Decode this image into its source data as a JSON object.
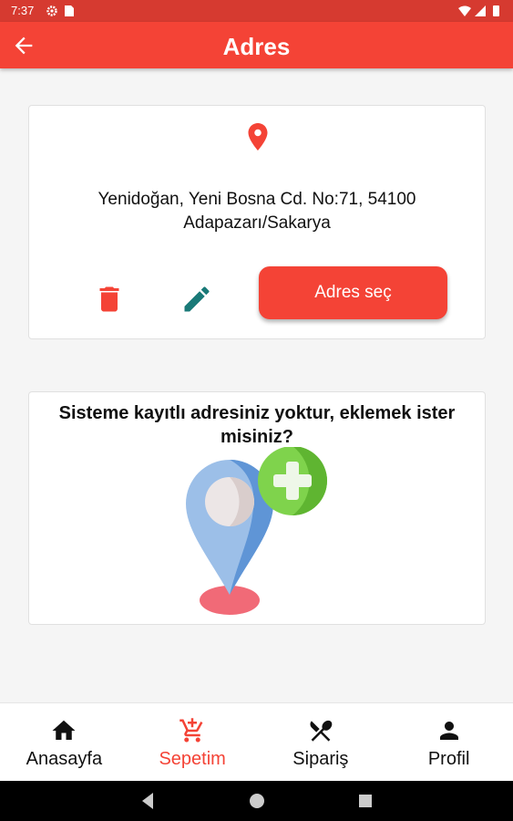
{
  "status_bar": {
    "time": "7:37",
    "left_icons": [
      "gear-icon",
      "sd-card-icon"
    ],
    "right_icons": [
      "wifi-icon",
      "signal-icon",
      "battery-icon"
    ]
  },
  "app_bar": {
    "title": "Adres",
    "back_icon": "arrow-back-icon"
  },
  "address_card": {
    "icon": "location-pin-icon",
    "address_line1": "Yenidoğan, Yeni Bosna Cd. No:71, 54100",
    "address_line2": "Adapazarı/Sakarya",
    "delete_icon": "trash-icon",
    "edit_icon": "pencil-icon",
    "select_button": "Adres seç"
  },
  "empty_card": {
    "prompt_line1": "Sisteme kayıtlı adresiniz yoktur, eklemek ister",
    "prompt_line2": "misiniz?",
    "illustration": "add-location-illustration"
  },
  "bottom_nav": {
    "items": [
      {
        "label": "Anasayfa",
        "icon": "home-icon",
        "active": false
      },
      {
        "label": "Sepetim",
        "icon": "cart-add-icon",
        "active": true
      },
      {
        "label": "Sipariş",
        "icon": "utensils-icon",
        "active": false
      },
      {
        "label": "Profil",
        "icon": "person-icon",
        "active": false
      }
    ]
  },
  "colors": {
    "primary": "#f44336",
    "status_bar": "#d63a30",
    "edit_icon": "#1a7a78",
    "illustration_blue": "#6a9ed8",
    "illustration_green": "#7fd34c"
  }
}
